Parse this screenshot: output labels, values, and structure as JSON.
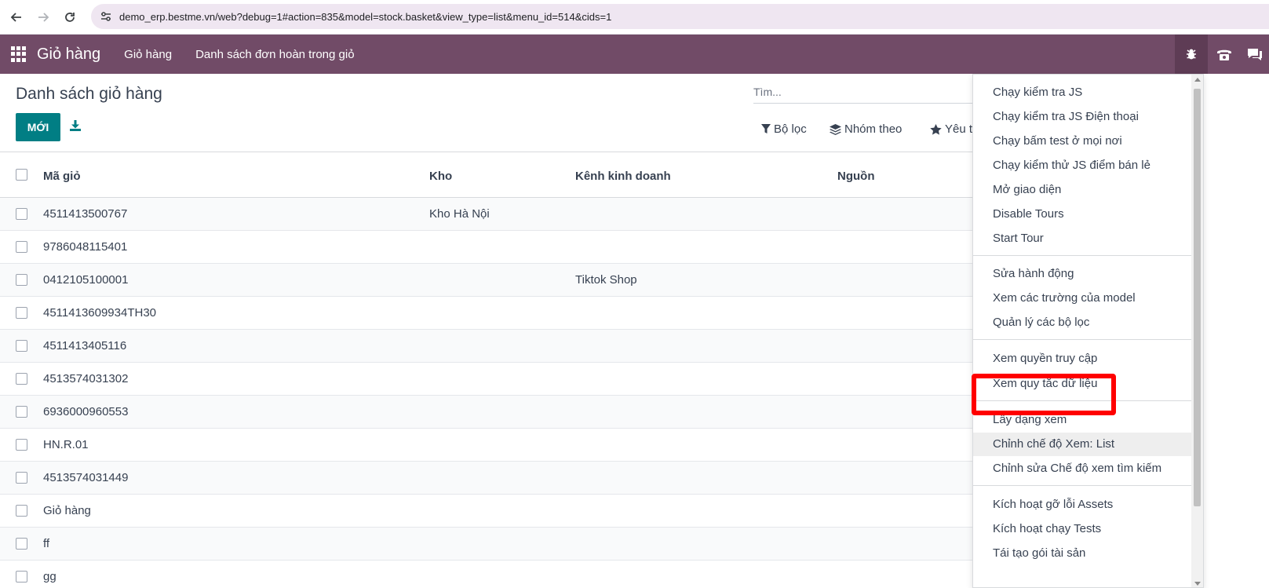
{
  "browser": {
    "url": "demo_erp.bestme.vn/web?debug=1#action=835&model=stock.basket&view_type=list&menu_id=514&cids=1"
  },
  "navbar": {
    "app_name": "Giỏ hàng",
    "menus": [
      "Giỏ hàng",
      "Danh sách đơn hoàn trong giỏ"
    ]
  },
  "control_panel": {
    "title": "Danh sách giỏ hàng",
    "new_button": "MỚI",
    "search_placeholder": "Tìm...",
    "filter_label": "Bộ lọc",
    "groupby_label": "Nhóm theo",
    "favorites_label": "Yêu t"
  },
  "table": {
    "columns": [
      "Mã giỏ",
      "Kho",
      "Kênh kinh doanh",
      "Nguồn"
    ],
    "rows": [
      {
        "code": "4511413500767",
        "warehouse": "Kho Hà Nội",
        "channel": ""
      },
      {
        "code": "9786048115401",
        "warehouse": "",
        "channel": ""
      },
      {
        "code": "0412105100001",
        "warehouse": "",
        "channel": "Tiktok Shop"
      },
      {
        "code": "4511413609934TH30",
        "warehouse": "",
        "channel": ""
      },
      {
        "code": "4511413405116",
        "warehouse": "",
        "channel": ""
      },
      {
        "code": "4513574031302",
        "warehouse": "",
        "channel": ""
      },
      {
        "code": "6936000960553",
        "warehouse": "",
        "channel": ""
      },
      {
        "code": "HN.R.01",
        "warehouse": "",
        "channel": ""
      },
      {
        "code": "4513574031449",
        "warehouse": "",
        "channel": ""
      },
      {
        "code": "Giỏ hàng",
        "warehouse": "",
        "channel": ""
      },
      {
        "code": "ff",
        "warehouse": "",
        "channel": ""
      },
      {
        "code": "gg",
        "warehouse": "",
        "channel": ""
      }
    ]
  },
  "debug_menu": {
    "items": [
      "Chạy kiểm tra JS",
      "Chạy kiểm tra JS Điện thoại",
      "Chạy bấm test ở mọi nơi",
      "Chạy kiểm thử JS điểm bán lẻ",
      "Mở giao diện",
      "Disable Tours",
      "Start Tour",
      "Sửa hành động",
      "Xem các trường của model",
      "Quản lý các bộ lọc",
      "Xem quyền truy cập",
      "Xem quy tắc dữ liệu",
      "Lấy dạng xem",
      "Chỉnh chế độ Xem: List",
      "Chỉnh sửa Chế độ xem tìm kiếm",
      "Kích hoạt gỡ lỗi Assets",
      "Kích hoạt chạy Tests",
      "Tái tạo gói tài sản"
    ],
    "highlighted_item": "Chỉnh chế độ Xem: List",
    "annotated_item": "Xem quy tắc dữ liệu"
  },
  "colors": {
    "navbar": "#714b67",
    "primary_button": "#017e84",
    "annotation": "#ff0000"
  }
}
